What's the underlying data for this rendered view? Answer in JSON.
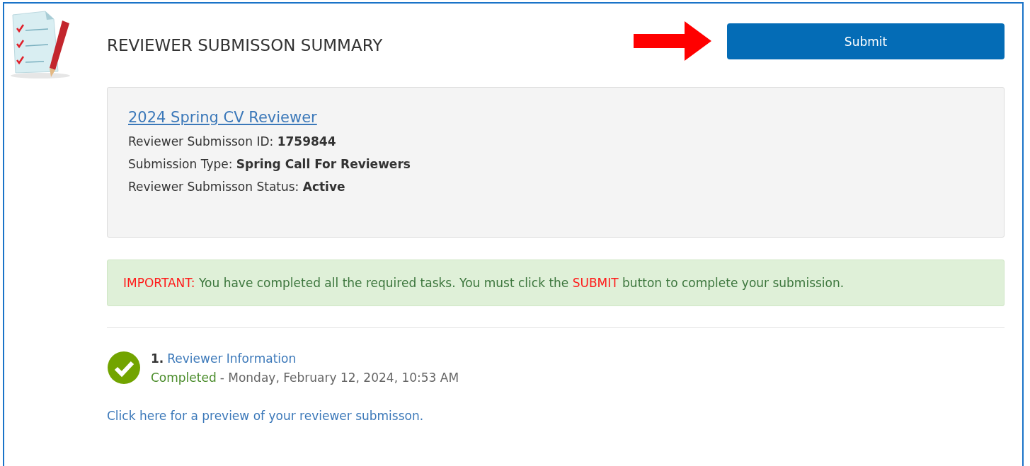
{
  "header": {
    "title": "REVIEWER SUBMISSON SUMMARY",
    "submit_button": "Submit"
  },
  "summary": {
    "link": "2024 Spring CV Reviewer",
    "lines": [
      "Reviewer Submisson ID: **1759844**",
      "Submission Type: **Spring Call For Reviewers**",
      "Reviewer Submisson Status: **Active**"
    ]
  },
  "notice": {
    "parts": [
      {
        "kind": "alert",
        "text": "IMPORTANT:"
      },
      {
        "kind": "plain",
        "text": " You have completed all the required tasks. You must click the "
      },
      {
        "kind": "alert",
        "text": "SUBMIT"
      },
      {
        "kind": "plain",
        "text": " button to complete your submission."
      }
    ]
  },
  "tasks": [
    {
      "number": "1.",
      "title": "Reviewer Information",
      "completed": true,
      "status": "Completed",
      "date": "- Monday, February 12, 2024, 10:53 AM"
    }
  ],
  "preview_link": "Click here for a preview of your reviewer submisson."
}
